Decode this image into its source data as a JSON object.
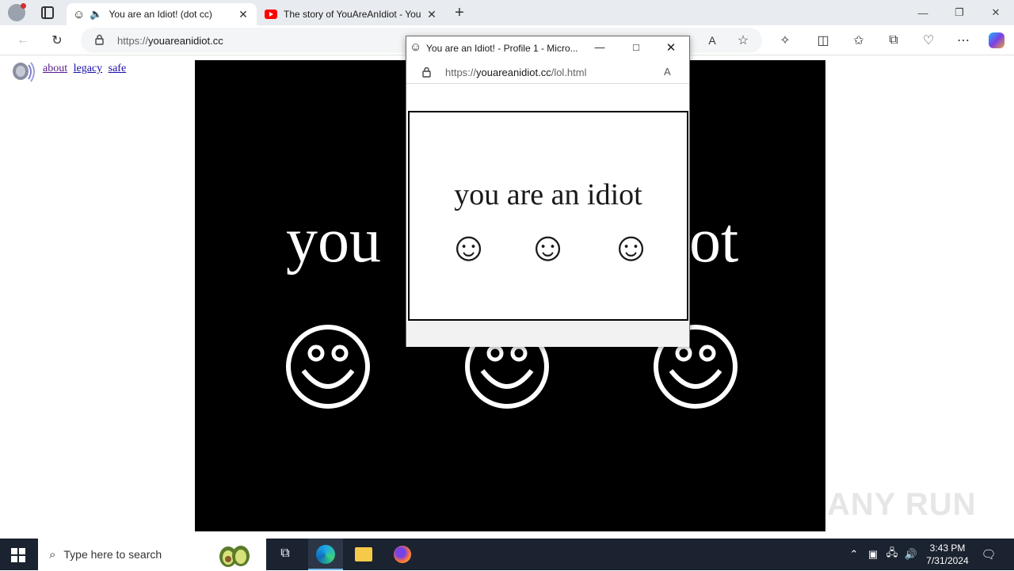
{
  "tabs": [
    {
      "title": "You are an Idiot! (dot cc)",
      "icon": "smiley-icon",
      "muted_icon": "speaker-icon",
      "active": true
    },
    {
      "title": "The story of YouAreAnIdiot - You",
      "icon": "youtube-icon",
      "active": false
    }
  ],
  "address": {
    "scheme": "https://",
    "host": "youareanidiot.cc"
  },
  "page": {
    "links": [
      "about",
      "legacy",
      "safe"
    ],
    "big_left": "you",
    "big_right": "ot",
    "watermark": "ANY RUN"
  },
  "popup": {
    "title": "You are an Idiot! - Profile 1 - Micro...",
    "url_scheme": "https://",
    "url_host": "youareanidiot.cc",
    "url_path": "/lol.html",
    "message": "you are an idiot",
    "smileys": [
      "☺",
      "☺",
      "☺"
    ]
  },
  "taskbar": {
    "search_placeholder": "Type here to search",
    "time": "3:43 PM",
    "date": "7/31/2024"
  },
  "colors": {
    "youtube_red": "#ff0000",
    "edge_blue": "#0f6cbd",
    "taskbar": "#1b2330"
  }
}
